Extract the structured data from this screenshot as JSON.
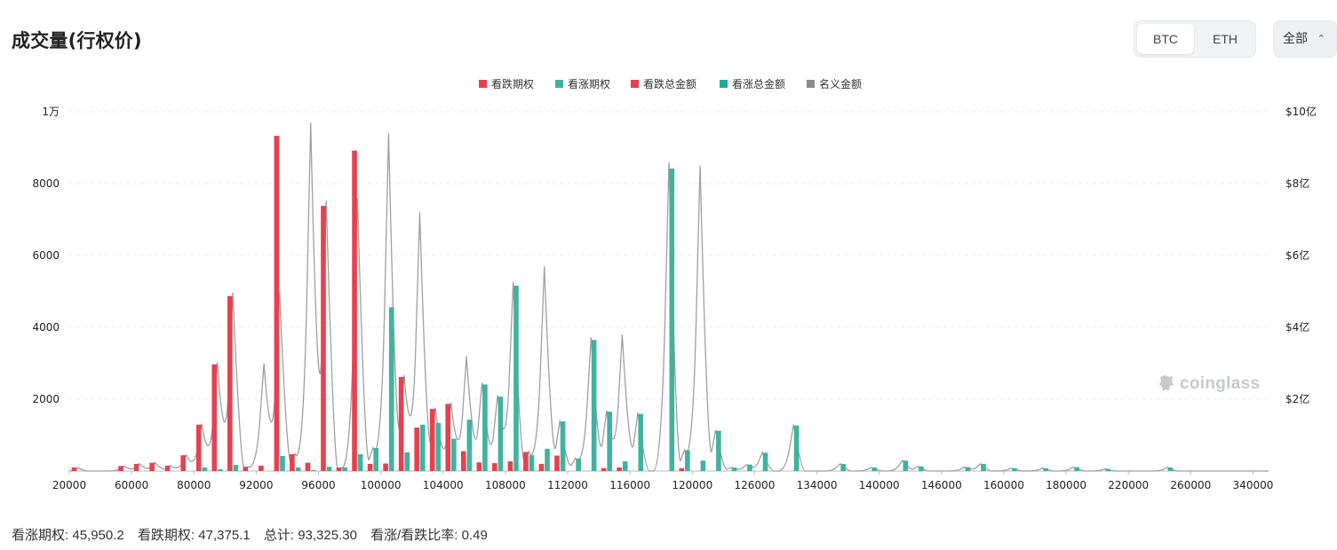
{
  "header": {
    "title": "成交量(行权价)"
  },
  "coin_toggle": {
    "options": [
      "BTC",
      "ETH"
    ],
    "selected": "BTC"
  },
  "filter": {
    "label": "全部",
    "icon": "sort-arrows-icon"
  },
  "watermark": {
    "text": "coinglass",
    "icon": "coinglass-logo-icon"
  },
  "footer": {
    "items": [
      {
        "label": "看涨期权",
        "value": "45,950.2"
      },
      {
        "label": "看跌期权",
        "value": "47,375.1"
      },
      {
        "label": "总计",
        "value": "93,325.30"
      },
      {
        "label": "看涨/看跌比率",
        "value": "0.49"
      }
    ]
  },
  "colors": {
    "put": "#e8404f",
    "call": "#3fb39e",
    "notional": "#a0a0a0",
    "grid": "#eeeeee",
    "axis": "#bbbbbb"
  },
  "chart_data": {
    "type": "bar",
    "legend": [
      {
        "name": "看跌期权",
        "color": "#e8404f"
      },
      {
        "name": "看涨期权",
        "color": "#3fb39e"
      },
      {
        "name": "看跌总金额",
        "color": "#e8404f"
      },
      {
        "name": "看涨总金额",
        "color": "#22ab94"
      },
      {
        "name": "名义金额",
        "color": "#8c8c8c"
      }
    ],
    "legend_position": "top-center",
    "y_left": {
      "ticks": [
        "1万",
        "8000",
        "6000",
        "4000",
        "2000"
      ],
      "tick_values": [
        10000,
        8000,
        6000,
        4000,
        2000
      ],
      "range": [
        0,
        10000
      ]
    },
    "y_right": {
      "ticks": [
        "$10亿",
        "$8亿",
        "$6亿",
        "$4亿",
        "$2亿"
      ],
      "tick_values": [
        1000000000,
        800000000,
        600000000,
        400000000,
        200000000
      ],
      "range": [
        0,
        1000000000
      ]
    },
    "grid": true,
    "x_tick_labels": [
      "20000",
      "60000",
      "80000",
      "92000",
      "96000",
      "100000",
      "104000",
      "108000",
      "112000",
      "116000",
      "120000",
      "126000",
      "134000",
      "140000",
      "146000",
      "160000",
      "180000",
      "220000",
      "260000",
      "340000"
    ],
    "x_tick_positions": [
      0,
      4,
      8,
      12,
      16,
      20,
      24,
      28,
      32,
      36,
      40,
      44,
      48,
      52,
      56,
      60,
      64,
      68,
      72,
      76
    ],
    "categories": [
      "20000",
      "25000",
      "30000",
      "50000",
      "60000",
      "65000",
      "70000",
      "75000",
      "80000",
      "83000",
      "85000",
      "88000",
      "92000",
      "93000",
      "94000",
      "95000",
      "96000",
      "97000",
      "98000",
      "99000",
      "100000",
      "101000",
      "102000",
      "103000",
      "104000",
      "105000",
      "106000",
      "107000",
      "108000",
      "109000",
      "110000",
      "111000",
      "112000",
      "113000",
      "114000",
      "115000",
      "116000",
      "117000",
      "118000",
      "119000",
      "120000",
      "122000",
      "124000",
      "125000",
      "126000",
      "128000",
      "130000",
      "132000",
      "134000",
      "135000",
      "136000",
      "138000",
      "140000",
      "142000",
      "144000",
      "145000",
      "146000",
      "150000",
      "155000",
      "158000",
      "160000",
      "170000",
      "175000",
      "180000",
      "200000",
      "210000",
      "220000",
      "230000",
      "240000",
      "250000",
      "260000",
      "280000",
      "300000",
      "320000",
      "330000",
      "340000",
      "350000"
    ],
    "series": [
      {
        "name": "看跌期权",
        "values": [
          100,
          0,
          0,
          140,
          200,
          230,
          150,
          440,
          1290,
          2970,
          4870,
          120,
          150,
          9330,
          470,
          230,
          7380,
          100,
          8920,
          200,
          210,
          2620,
          1210,
          1730,
          1870,
          550,
          240,
          220,
          270,
          530,
          200,
          430,
          0,
          0,
          80,
          100,
          0,
          0,
          0,
          80,
          0,
          0,
          0,
          0,
          0,
          0,
          0,
          0,
          0,
          0,
          0,
          0,
          0,
          0,
          0,
          0,
          0,
          0,
          0,
          0,
          0,
          0,
          0,
          0,
          0,
          0,
          0,
          0,
          0,
          0,
          0,
          0,
          0,
          0,
          0,
          0,
          0
        ]
      },
      {
        "name": "看涨期权",
        "values": [
          0,
          0,
          0,
          0,
          0,
          0,
          0,
          0,
          100,
          50,
          170,
          0,
          0,
          420,
          100,
          30,
          120,
          100,
          470,
          640,
          4560,
          520,
          1290,
          1340,
          900,
          1430,
          2410,
          2070,
          5160,
          440,
          620,
          1380,
          350,
          3650,
          1650,
          270,
          1590,
          0,
          8420,
          580,
          290,
          1120,
          100,
          180,
          510,
          0,
          1270,
          0,
          0,
          200,
          0,
          100,
          0,
          290,
          130,
          0,
          0,
          110,
          200,
          0,
          80,
          0,
          80,
          0,
          110,
          0,
          60,
          0,
          0,
          0,
          100,
          0,
          0,
          0,
          0,
          0,
          0
        ]
      }
    ],
    "notional_peaks": [
      {
        "category": "92000",
        "value": 3000000000
      },
      {
        "category": "93000",
        "value": 5000000000
      },
      {
        "category": "95000",
        "value": 9700000000
      },
      {
        "category": "98000",
        "value": 7600000000
      },
      {
        "category": "100000",
        "value": 9400000000
      },
      {
        "category": "102000",
        "value": 7200000000
      },
      {
        "category": "105000",
        "value": 3200000000
      },
      {
        "category": "110000",
        "value": 5700000000
      },
      {
        "category": "115000",
        "value": 3800000000
      },
      {
        "category": "120000",
        "value": 8500000000
      }
    ]
  }
}
